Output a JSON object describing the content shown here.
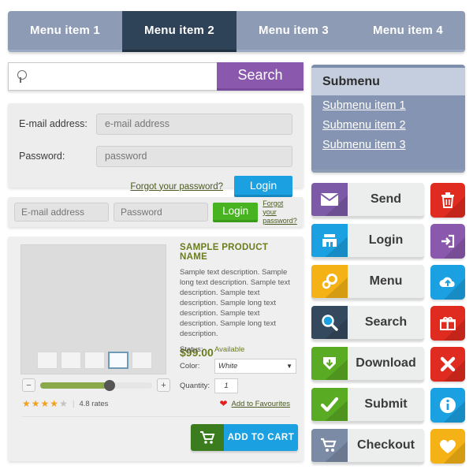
{
  "menu": {
    "items": [
      {
        "label": "Menu item 1",
        "active": false
      },
      {
        "label": "Menu item 2",
        "active": true
      },
      {
        "label": "Menu item 3",
        "active": false
      },
      {
        "label": "Menu item 4",
        "active": false
      }
    ]
  },
  "search": {
    "icon": "search-icon",
    "value": "",
    "placeholder": "",
    "button_label": "Search",
    "button_color": "#8a59ad"
  },
  "login_panel": {
    "email_label": "E-mail address:",
    "email_placeholder": "e-mail address",
    "password_label": "Password:",
    "password_placeholder": "password",
    "forgot_label": "Forgot your password?",
    "login_label": "Login",
    "login_color": "#1ba1e2"
  },
  "login_bar": {
    "email_placeholder": "E-mail address",
    "password_placeholder": "Password",
    "login_label": "Login",
    "login_color": "#47b320",
    "forgot_label": "Forgot your password?"
  },
  "submenu": {
    "title": "Submenu",
    "items": [
      {
        "label": "Submenu item 1"
      },
      {
        "label": "Submenu item 2"
      },
      {
        "label": "Submenu item 3"
      }
    ]
  },
  "product": {
    "title": "SAMPLE PRODUCT NAME",
    "description": "Sample text description. Sample long text description. Sample text description. Sample text description. Sample long text description. Sample text description. Sample long text description.",
    "price": "$99.00",
    "status_label": "Status:",
    "status_value": "Available",
    "color_label": "Color:",
    "color_value": "White",
    "quantity_label": "Quantity:",
    "quantity_value": "1",
    "thumbnails": [
      {
        "selected": false
      },
      {
        "selected": false
      },
      {
        "selected": false
      },
      {
        "selected": true
      },
      {
        "selected": false
      }
    ],
    "slider": {
      "minus": "−",
      "plus": "+",
      "percent": 60
    },
    "rating": {
      "filled": 4,
      "total": 5,
      "text": "4.8 rates"
    },
    "favourite_label": "Add to Favourites",
    "cart_label": "ADD TO CART",
    "cart_icon": "shopping-cart-icon"
  },
  "buttons": {
    "wide": [
      {
        "label": "Send",
        "icon": "envelope-icon",
        "color": "#7d5aa8"
      },
      {
        "label": "Login",
        "icon": "login-building-icon",
        "color": "#1ba1e2"
      },
      {
        "label": "Menu",
        "icon": "gears-icon",
        "color": "#f5b216"
      },
      {
        "label": "Search",
        "icon": "magnifier-icon",
        "color": "#34495e"
      },
      {
        "label": "Download",
        "icon": "download-shield-icon",
        "color": "#5aab24"
      },
      {
        "label": "Submit",
        "icon": "checkmark-icon",
        "color": "#5aab24"
      },
      {
        "label": "Checkout",
        "icon": "cart-icon",
        "color": "#7b8aa5"
      }
    ],
    "square": [
      {
        "icon": "trash-icon",
        "color": "#e02b20"
      },
      {
        "icon": "logout-arrow-icon",
        "color": "#8a59ad"
      },
      {
        "icon": "cloud-upload-icon",
        "color": "#1ba1e2"
      },
      {
        "icon": "gift-icon",
        "color": "#e02b20"
      },
      {
        "icon": "close-x-icon",
        "color": "#e02b20"
      },
      {
        "icon": "info-icon",
        "color": "#1ba1e2"
      },
      {
        "icon": "heart-icon",
        "color": "#f5b216"
      }
    ]
  }
}
